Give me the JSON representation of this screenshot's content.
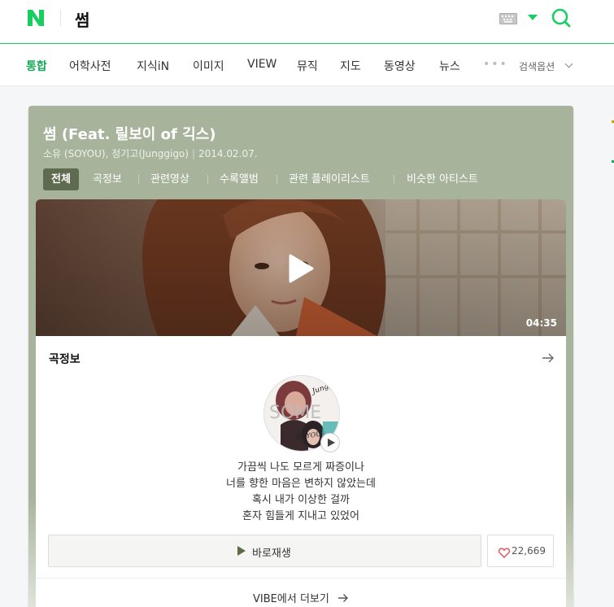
{
  "header": {
    "logo_icon": "naver-n-logo-icon",
    "query": "썸",
    "keyboard_icon": "keyboard-icon",
    "search_icon": "search-icon",
    "accent_color": "#19ce60"
  },
  "tabs": {
    "items": [
      {
        "label": "통합",
        "active": true
      },
      {
        "label": "어학사전",
        "active": false
      },
      {
        "label": "지식iN",
        "active": false
      },
      {
        "label": "이미지",
        "active": false
      },
      {
        "label": "VIEW",
        "active": false
      },
      {
        "label": "뮤직",
        "active": false
      },
      {
        "label": "지도",
        "active": false
      },
      {
        "label": "동영상",
        "active": false
      },
      {
        "label": "뉴스",
        "active": false
      }
    ],
    "more": "•••",
    "options_label": "검색옵션"
  },
  "card": {
    "title": "썸 (Feat. 릴보이 of 긱스)",
    "artists": "소유 (SOYOU), 정기고(Junggigo)",
    "date": "2014.02.07.",
    "pills": [
      {
        "label": "전체",
        "active": true
      },
      {
        "label": "곡정보",
        "active": false
      },
      {
        "label": "관련영상",
        "active": false
      },
      {
        "label": "수록앨범",
        "active": false
      },
      {
        "label": "관련 플레이리스트",
        "active": false
      },
      {
        "label": "비슷한 아티스트",
        "active": false
      }
    ],
    "card_color": "#a8b39b"
  },
  "video": {
    "duration": "04:35",
    "play_icon": "play-icon"
  },
  "info": {
    "section_title": "곡정보",
    "arrow_icon": "arrow-right-icon",
    "album_text_top": "Junggigo",
    "album_text_mid": "SOME",
    "album_text_bottom": "SOYOU",
    "lyrics": [
      "가끔씩 나도 모르게 짜증이나",
      "너를 향한 마음은 변하지 않았는데",
      "혹시 내가 이상한 걸까",
      "혼자 힘들게 지내고 있었어"
    ],
    "play_now_label": "바로재생",
    "like_count": "22,669",
    "heart_icon": "heart-icon",
    "more_link": "VIBE에서 더보기"
  }
}
